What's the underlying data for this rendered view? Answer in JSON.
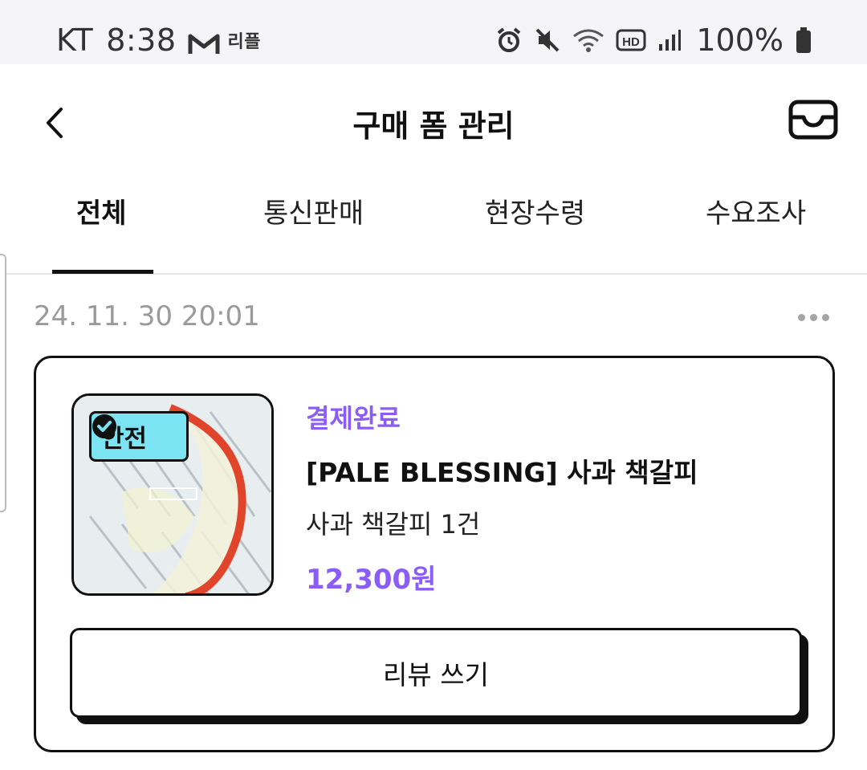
{
  "status_bar": {
    "carrier": "KT",
    "time": "8:38",
    "app_label": "리플",
    "battery": "100%",
    "icons": [
      "gmail-icon",
      "alarm-icon",
      "mute-icon",
      "wifi-icon",
      "hd-icon",
      "signal-icon",
      "battery-icon"
    ]
  },
  "header": {
    "title": "구매 폼 관리",
    "back_icon": "chevron-left-icon",
    "inbox_icon": "inbox-icon"
  },
  "tabs": [
    {
      "label": "전체",
      "active": true
    },
    {
      "label": "통신판매",
      "active": false
    },
    {
      "label": "현장수령",
      "active": false
    },
    {
      "label": "수요조사",
      "active": false
    }
  ],
  "order": {
    "date": "24. 11. 30 20:01",
    "more_icon": "more-horizontal-icon",
    "badge": "안전",
    "status": "결제완료",
    "product_name": "[PALE BLESSING] 사과 책갈피",
    "option": "사과 책갈피 1건",
    "price": "12,300원",
    "review_button": "리뷰 쓰기"
  },
  "colors": {
    "accent": "#8b5cf6",
    "badge_bg": "#7ce3f2",
    "text": "#111111",
    "muted": "#9a9a9a"
  }
}
